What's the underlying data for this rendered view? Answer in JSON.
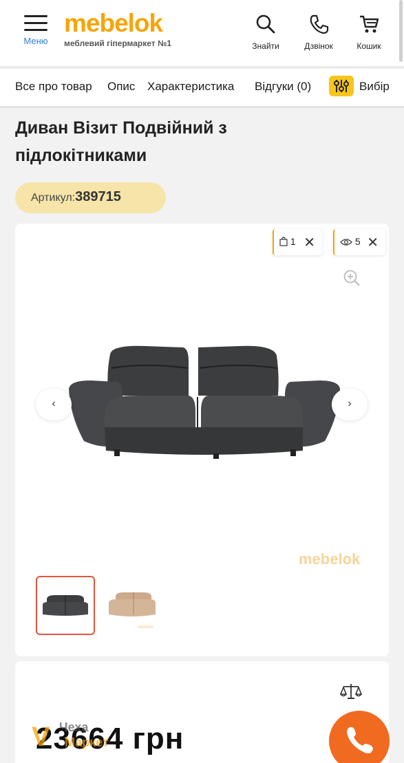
{
  "header": {
    "menu_label": "Меню",
    "logo": "mebelok",
    "logo_subtitle": "меблевий гіпермаркет №1",
    "search_label": "Знайти",
    "call_label": "Дзвінок",
    "cart_label": "Кошик"
  },
  "tabs": {
    "all": "Все про товар",
    "description": "Опис",
    "specs": "Характеристика",
    "reviews": "Відгуки (0)",
    "choice": "Вибір"
  },
  "product": {
    "title": "Диван Візит Подвійний з підлокітниками",
    "sku_label": "Артикул:",
    "sku_value": "389715",
    "compare_count": "1",
    "views_count": "5",
    "watermark": "mebelok",
    "price": "23664 грн"
  },
  "overlay": {
    "letter": "V",
    "line1": "Чеха",
    "line2": "Маркет"
  },
  "colors": {
    "brand": "#f5a50b",
    "accent_link": "#2f7fd6",
    "call_button": "#f06a1f",
    "sku_badge": "#f7e4a9",
    "active_thumb_border": "#e2543c"
  },
  "icons": [
    "menu-icon",
    "search-icon",
    "phone-icon",
    "cart-icon",
    "filter-icon",
    "compare-icon",
    "eye-icon",
    "close-icon",
    "zoom-icon",
    "chevron-left-icon",
    "chevron-right-icon",
    "scale-icon",
    "phone-icon"
  ]
}
